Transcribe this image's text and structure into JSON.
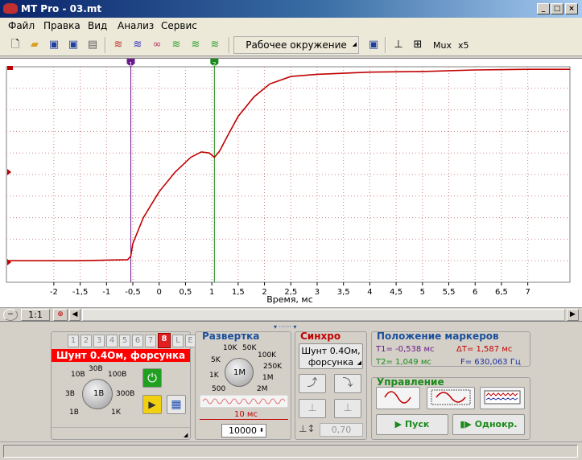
{
  "window": {
    "title": "MT Pro - 03.mt"
  },
  "menu": [
    "Файл",
    "Правка",
    "Вид",
    "Анализ",
    "Сервис"
  ],
  "toolbar": {
    "environment": "Рабочее окружение",
    "mux": "Mux",
    "x5": "x5"
  },
  "plot": {
    "xlabel": "Время, мс",
    "xticks": [
      "-2",
      "-1,5",
      "-1",
      "-0,5",
      "0",
      "0,5",
      "1",
      "1,5",
      "2",
      "2,5",
      "3",
      "3,5",
      "4",
      "4,5",
      "5",
      "5,5",
      "6",
      "6,5",
      "7"
    ],
    "marker1_label": "1",
    "marker2_label": "2",
    "trace_color": "#c00000"
  },
  "chart_data": {
    "type": "line",
    "xlabel": "Время, мс",
    "xlim": [
      -2.9,
      7.8
    ],
    "series": [
      {
        "x": [
          -2.85,
          -1.5,
          -0.6,
          -0.54,
          -0.5,
          -0.3,
          0,
          0.3,
          0.6,
          0.8,
          0.95,
          1.05,
          1.15,
          1.3,
          1.5,
          1.8,
          2.1,
          2.5,
          3,
          4,
          5,
          6,
          7,
          7.8
        ],
        "y": [
          0.1,
          0.1,
          0.105,
          0.12,
          0.18,
          0.3,
          0.42,
          0.51,
          0.58,
          0.605,
          0.6,
          0.58,
          0.61,
          0.68,
          0.77,
          0.86,
          0.92,
          0.955,
          0.965,
          0.975,
          0.978,
          0.985,
          0.988,
          0.988
        ]
      }
    ]
  },
  "scroll": {
    "zoom": "1:1"
  },
  "channels": {
    "buttons": [
      "1",
      "2",
      "3",
      "4",
      "5",
      "6",
      "7",
      "8",
      "L",
      "E"
    ],
    "active": "8",
    "name": "Шунт 0.4Ом, форсунка",
    "knob_labels": [
      "10В",
      "30В",
      "100В",
      "3В",
      "1В",
      "300В",
      "1В",
      "1К"
    ],
    "center": "1В"
  },
  "sweep": {
    "title": "Развертка",
    "knob_labels": [
      "10K",
      "50K",
      "5K",
      "100K",
      "1K",
      "250K",
      "500",
      "1M",
      "2M"
    ],
    "center": "1M",
    "time_label": "10 мс",
    "samples": "10000"
  },
  "sync": {
    "title": "Синхро",
    "source": "Шунт 0.4Ом, форсунка",
    "level": "0,70"
  },
  "markers": {
    "title": "Положение маркеров",
    "t1": "T1= -0,538 мс",
    "t2": "T2= 1,049 мс",
    "dt": "ΔT= 1,587 мс",
    "f": "F= 630,063 Гц"
  },
  "control": {
    "title": "Управление",
    "start": "Пуск",
    "single": "Однокр."
  }
}
